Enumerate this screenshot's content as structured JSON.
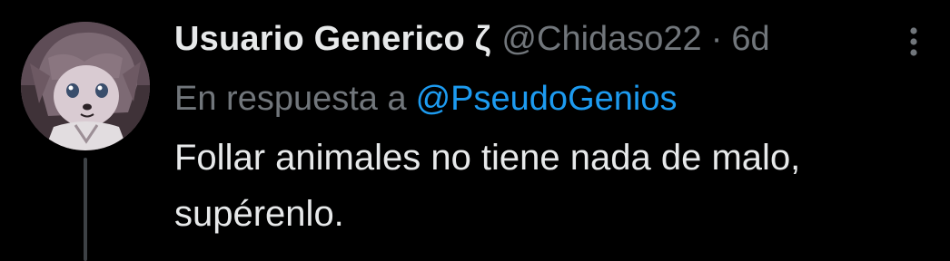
{
  "tweet": {
    "display_name": "Usuario Generico ζ",
    "handle": "@Chidaso22",
    "separator": "·",
    "time": "6d",
    "reply_prefix": "En respuesta a",
    "reply_to": "@PseudoGenios",
    "text": "Follar animales no tiene nada de malo, supérenlo."
  },
  "icons": {
    "more": "more-vertical-icon",
    "avatar": "avatar-image"
  },
  "colors": {
    "background": "#000000",
    "primary_text": "#e7e9ea",
    "secondary_text": "#71767b",
    "link": "#1d9bf0",
    "thread_line": "#3d4145"
  }
}
